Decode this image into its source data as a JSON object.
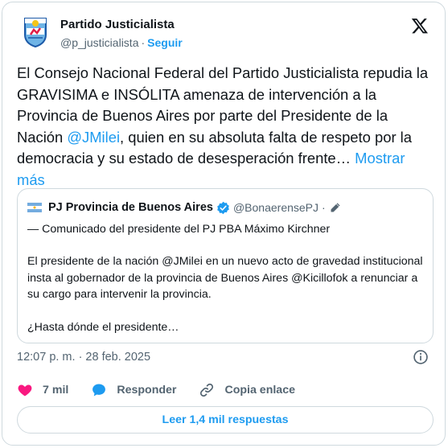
{
  "author": {
    "name": "Partido Justicialista",
    "handle": "@p_justicialista",
    "separator": "·",
    "follow_label": "Seguir"
  },
  "tweet": {
    "text_before": "El Consejo Nacional Federal del Partido Justicialista repudia la GRAVISIMA e INSÓLITA amenaza de intervención a la Provincia de Buenos Aires por parte del Presidente de la Nación ",
    "mention": "@JMilei",
    "text_after": ", quien en su absoluta falta de respeto por la democracia y su estado de desesperación frente…",
    "show_more": "Mostrar más"
  },
  "quote": {
    "name": "PJ Provincia de Buenos Aires",
    "handle": "@BonaerensePJ",
    "separator": "·",
    "line1": "— Comunicado del presidente del PJ PBA Máximo Kirchner",
    "line2": "El presidente de la nación @JMilei en un nuevo acto de gravedad institucional insta al gobernador de la provincia de Buenos Aires @Kicillofok a renunciar a su cargo para intervenir la provincia.",
    "line3": "¿Hasta dónde el presidente…"
  },
  "meta": {
    "timestamp": "12:07 p. m. · 28 feb. 2025"
  },
  "actions": {
    "likes": "7 mil",
    "reply_label": "Responder",
    "copy_label": "Copia enlace"
  },
  "replies_button": "Leer 1,4 mil respuestas",
  "icons": {
    "avatar": "pj-shield-logo",
    "x_logo": "x-logo-icon",
    "verified": "verified-badge-icon",
    "info": "info-icon",
    "heart": "heart-icon",
    "reply": "reply-bubble-icon",
    "link": "link-icon"
  },
  "colors": {
    "accent": "#1d9bf0",
    "heart": "#f91880",
    "text": "#0f1419",
    "muted": "#536471",
    "border": "#cfd9de"
  }
}
